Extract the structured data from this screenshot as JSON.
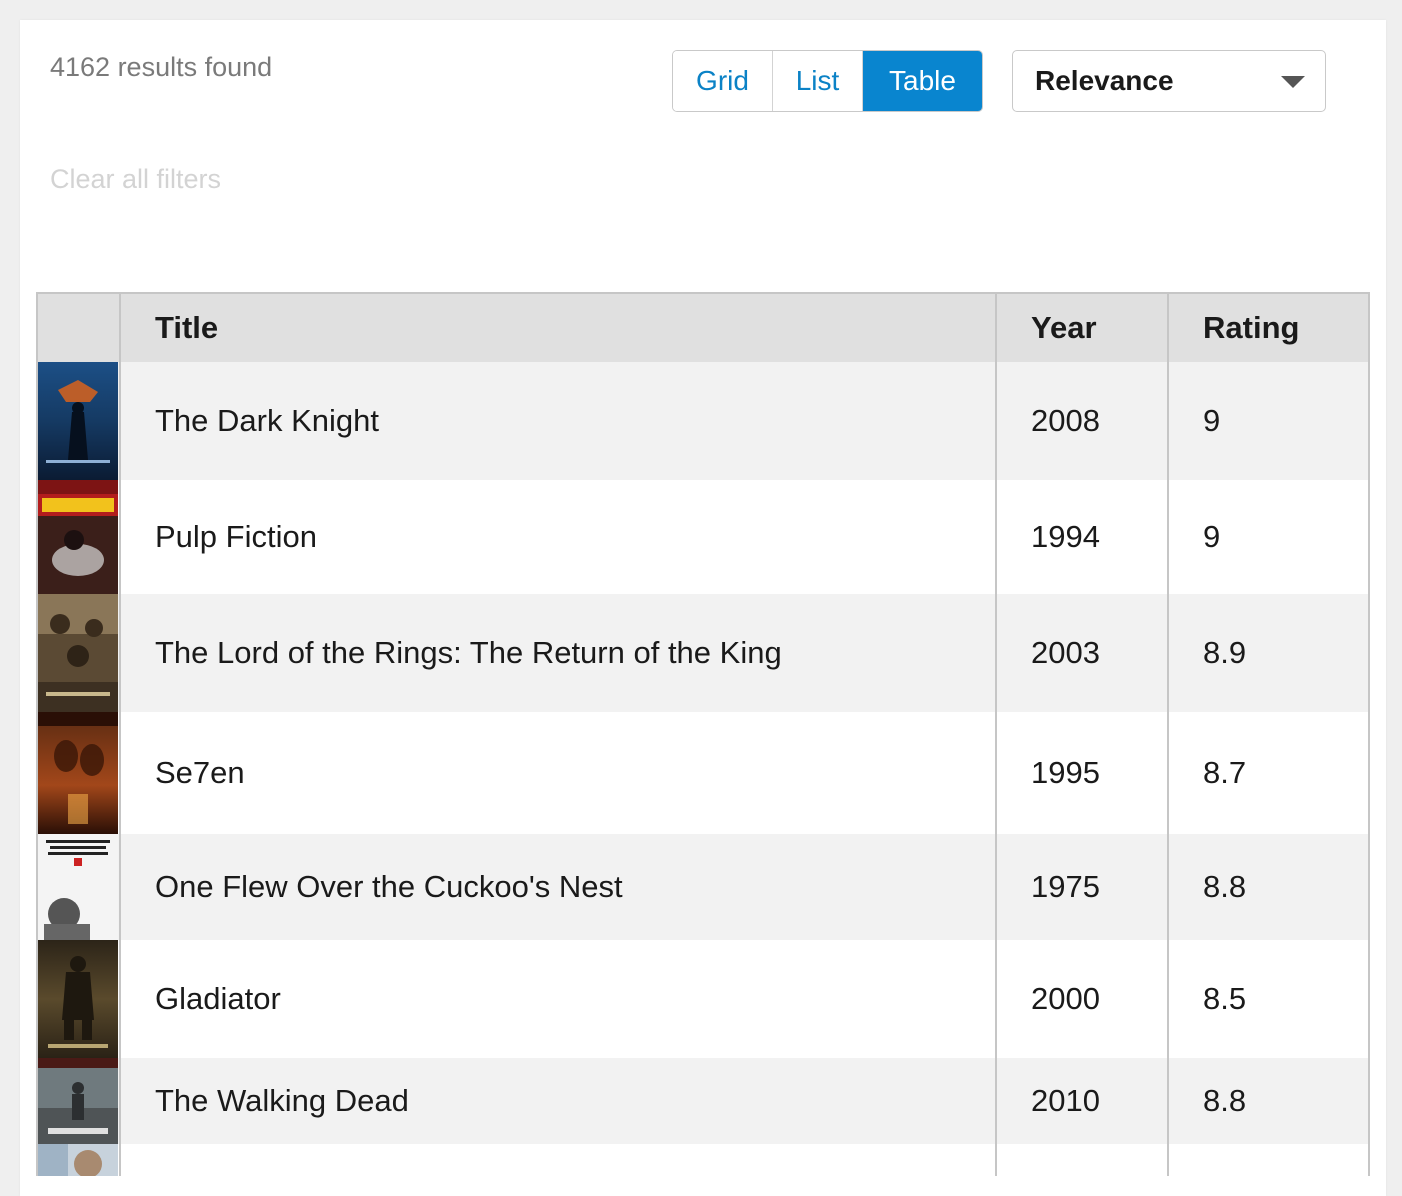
{
  "header": {
    "results_text": "4162 results found",
    "clear_filters_label": "Clear all filters"
  },
  "view_toggle": {
    "options": [
      {
        "label": "Grid",
        "active": false
      },
      {
        "label": "List",
        "active": false
      },
      {
        "label": "Table",
        "active": true
      }
    ]
  },
  "sort": {
    "selected": "Relevance",
    "icon": "chevron-down-icon"
  },
  "table": {
    "columns": [
      "Title",
      "Year",
      "Rating"
    ],
    "rows": [
      {
        "title": "The Dark Knight",
        "year": "2008",
        "rating": "9"
      },
      {
        "title": "Pulp Fiction",
        "year": "1994",
        "rating": "9"
      },
      {
        "title": "The Lord of the Rings: The Return of the King",
        "year": "2003",
        "rating": "8.9"
      },
      {
        "title": "Se7en",
        "year": "1995",
        "rating": "8.7"
      },
      {
        "title": "One Flew Over the Cuckoo's Nest",
        "year": "1975",
        "rating": "8.8"
      },
      {
        "title": "Gladiator",
        "year": "2000",
        "rating": "8.5"
      },
      {
        "title": "The Walking Dead",
        "year": "2010",
        "rating": "8.8"
      },
      {
        "title": "",
        "year": "",
        "rating": ""
      }
    ]
  },
  "colors": {
    "accent": "#0985cf",
    "link": "#0b82c6",
    "header_bg": "#e0e0e0",
    "row_alt": "#f2f2f2"
  }
}
